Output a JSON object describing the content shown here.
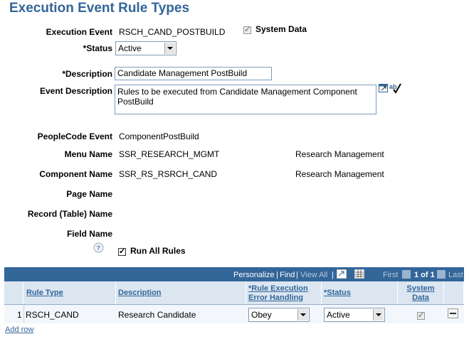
{
  "page": {
    "title": "Execution Event Rule Types"
  },
  "form": {
    "execution_event_label": "Execution Event",
    "execution_event_value": "RSCH_CAND_POSTBUILD",
    "system_data_label": "System Data",
    "system_data_checked": true,
    "status_label": "*Status",
    "status_value": "Active",
    "description_label": "*Description",
    "description_value": "Candidate Management PostBuild",
    "event_description_label": "Event Description",
    "event_description_line1": "Rules to be executed from Candidate Management  Component",
    "event_description_line2": "PostBuild",
    "peoplecode_event_label": "PeopleCode Event",
    "peoplecode_event_value": "ComponentPostBuild",
    "menu_name_label": "Menu Name",
    "menu_name_value": "SSR_RESEARCH_MGMT",
    "menu_name_desc": "Research Management",
    "component_name_label": "Component Name",
    "component_name_value": "SSR_RS_RSRCH_CAND",
    "component_name_desc": "Research Management",
    "page_name_label": "Page Name",
    "record_name_label": "Record (Table) Name",
    "field_name_label": "Field Name",
    "run_all_rules_label": "Run All Rules",
    "run_all_rules_checked": true
  },
  "grid": {
    "personalize": "Personalize",
    "find": "Find",
    "view_all": "View All",
    "first": "First",
    "page_info": "1 of 1",
    "last": "Last",
    "columns": {
      "rule_type": "Rule Type",
      "description": "Description",
      "error_handling_1": "*Rule Execution",
      "error_handling_2": "Error Handling",
      "status": "*Status",
      "system_data_1": "System",
      "system_data_2": "Data"
    },
    "rows": [
      {
        "num": "1",
        "rule_type": "RSCH_CAND",
        "description": "Research Candidate",
        "error_handling": "Obey",
        "status": "Active",
        "system_data": true
      }
    ],
    "add_row": "Add row"
  },
  "icons": [
    "zoom-icon",
    "spellcheck-icon",
    "help-icon",
    "download-icon",
    "grid-view-icon",
    "nav-first-icon",
    "nav-next-icon",
    "delete-row-icon"
  ],
  "colors": {
    "heading": "#336699",
    "grid_header": "#336699",
    "column_header": "#dbe6f1"
  }
}
